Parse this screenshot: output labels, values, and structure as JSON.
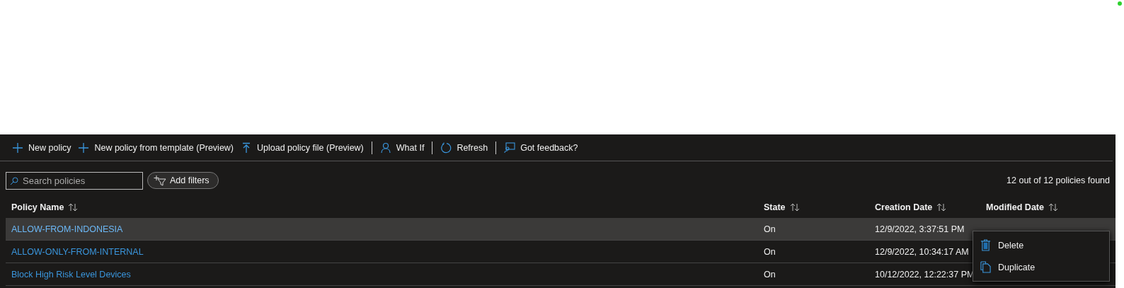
{
  "toolbar": [
    {
      "kind": "add",
      "label": "New policy"
    },
    {
      "kind": "add",
      "label": "New policy from template (Preview)"
    },
    {
      "kind": "upload",
      "label": "Upload policy file (Preview)"
    },
    {
      "kind": "person",
      "label": "What If"
    },
    {
      "kind": "refresh",
      "label": "Refresh"
    },
    {
      "kind": "feedback",
      "label": "Got feedback?"
    }
  ],
  "search": {
    "placeholder": "Search policies"
  },
  "filter_button": "Add filters",
  "result_count": "12 out of 12 policies found",
  "table": {
    "columns": [
      "Policy Name",
      "State",
      "Creation Date",
      "Modified Date"
    ],
    "rows": [
      {
        "name": "ALLOW-FROM-INDONESIA",
        "state": "On",
        "created": "12/9/2022, 3:37:51 PM",
        "selected": true
      },
      {
        "name": "ALLOW-ONLY-FROM-INTERNAL",
        "state": "On",
        "created": "12/9/2022, 10:34:17 AM",
        "selected": false
      },
      {
        "name": "Block High Risk Level Devices",
        "state": "On",
        "created": "10/12/2022, 12:22:37 PM",
        "selected": false
      }
    ]
  },
  "context_menu": [
    {
      "kind": "delete",
      "label": "Delete"
    },
    {
      "kind": "duplicate",
      "label": "Duplicate"
    }
  ]
}
